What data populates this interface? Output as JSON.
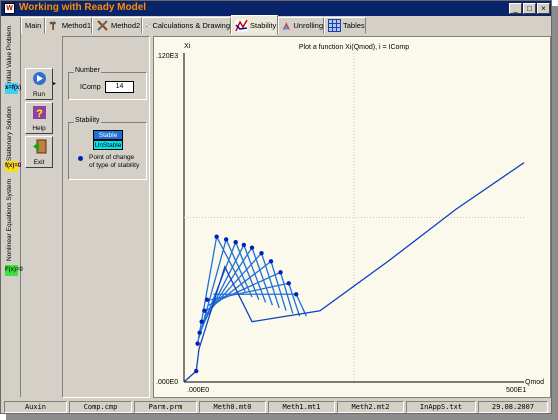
{
  "window": {
    "title": "Working with Ready Model",
    "app_icon_label": "W"
  },
  "title_buttons": [
    {
      "name": "minimize-button",
      "glyph": "_"
    },
    {
      "name": "maximize-button",
      "glyph": "□"
    },
    {
      "name": "close-button",
      "glyph": "×"
    }
  ],
  "tabs": [
    {
      "label": "Main",
      "icon": ""
    },
    {
      "label": "Method1",
      "icon": "hammer-icon"
    },
    {
      "label": "Method2",
      "icon": "tools-icon"
    },
    {
      "label": "Calculations & Drawing",
      "icon": "graph-icon"
    },
    {
      "label": "Stability",
      "icon": "stability-icon"
    },
    {
      "label": "Unrolling",
      "icon": "unrolling-icon"
    },
    {
      "label": "Tables",
      "icon": "table-icon"
    }
  ],
  "active_tab": "Stability",
  "side_tabs": [
    {
      "label": "Initial Value Problem",
      "icon_text": "x=f(x)"
    },
    {
      "label": "Stationary Solution",
      "icon_text": "f(x)=0"
    },
    {
      "label": "Nonlinear Equations System",
      "icon_text": "F(x)=0"
    }
  ],
  "tools": {
    "run": "Run",
    "help": "Help",
    "exit": "Exit"
  },
  "number_group": {
    "title": "Number",
    "field_label": "IComp",
    "field_value": "14"
  },
  "stability_group": {
    "title": "Stability",
    "stable": "Stable",
    "unstable": "UnStable",
    "legend_text_1": "Point of change",
    "legend_text_2": "of type of stability"
  },
  "colors": {
    "title_bg": "#0a246a",
    "title_text": "#ff8c00",
    "stable": "#1e6fd8",
    "unstable": "#00e5ee",
    "curve": "#1040c0",
    "point": "#0020c0"
  },
  "chart_data": {
    "type": "line",
    "title": "Plot a function Xi(Qmod), i = IComp",
    "xlabel": "Qmod",
    "ylabel": "Xi",
    "x_tick_labels": [
      ".000E0",
      "500E1"
    ],
    "y_tick_labels": [
      ".000E0",
      ".120E3"
    ],
    "xlim": [
      0,
      5000
    ],
    "ylim": [
      0,
      120
    ],
    "grid": "dotted crosshair at midpoints",
    "series": [
      {
        "values": [
          [
            0,
            0
          ],
          [
            180,
            4
          ],
          [
            220,
            12
          ],
          [
            600,
            42
          ],
          [
            1000,
            22
          ],
          [
            2000,
            26
          ],
          [
            3000,
            44
          ],
          [
            4000,
            63
          ],
          [
            5000,
            80
          ]
        ]
      }
    ],
    "fan_lines": [
      [
        [
          200,
          14
        ],
        [
          480,
          53
        ],
        [
          900,
          33
        ]
      ],
      [
        [
          220,
          16
        ],
        [
          620,
          52
        ],
        [
          1000,
          31
        ]
      ],
      [
        [
          240,
          18
        ],
        [
          760,
          51
        ],
        [
          1100,
          30
        ]
      ],
      [
        [
          260,
          20
        ],
        [
          880,
          50
        ],
        [
          1200,
          29
        ]
      ],
      [
        [
          280,
          22
        ],
        [
          1000,
          49
        ],
        [
          1300,
          28
        ]
      ],
      [
        [
          300,
          24
        ],
        [
          1140,
          47
        ],
        [
          1400,
          27
        ]
      ],
      [
        [
          330,
          26
        ],
        [
          1280,
          44
        ],
        [
          1500,
          26
        ]
      ],
      [
        [
          360,
          28
        ],
        [
          1420,
          40
        ],
        [
          1600,
          25
        ]
      ],
      [
        [
          390,
          30
        ],
        [
          1540,
          36
        ],
        [
          1700,
          24
        ]
      ],
      [
        [
          430,
          32
        ],
        [
          1650,
          32
        ],
        [
          1800,
          24
        ]
      ]
    ],
    "change_points": [
      [
        180,
        4
      ],
      [
        200,
        14
      ],
      [
        230,
        18
      ],
      [
        260,
        22
      ],
      [
        300,
        26
      ],
      [
        340,
        30
      ],
      [
        480,
        53
      ],
      [
        620,
        52
      ],
      [
        760,
        51
      ],
      [
        880,
        50
      ],
      [
        1000,
        49
      ],
      [
        1140,
        47
      ],
      [
        1280,
        44
      ],
      [
        1420,
        40
      ],
      [
        1540,
        36
      ],
      [
        1650,
        32
      ]
    ]
  },
  "statusbar": [
    "Auxin",
    "Comp.cmp",
    "Parm.prm",
    "Meth0.mt0",
    "Meth1.mt1",
    "Meth2.mt2",
    "InAppS.txt",
    "29.08.2007"
  ]
}
